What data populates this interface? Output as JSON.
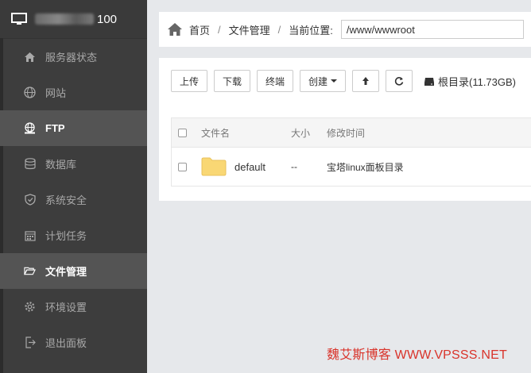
{
  "sidebar": {
    "server_title": "100",
    "items": [
      {
        "label": "服务器状态",
        "icon": "home-icon"
      },
      {
        "label": "网站",
        "icon": "globe-icon"
      },
      {
        "label": "FTP",
        "icon": "ftp-globe-icon"
      },
      {
        "label": "数据库",
        "icon": "database-icon"
      },
      {
        "label": "系统安全",
        "icon": "shield-icon"
      },
      {
        "label": "计划任务",
        "icon": "calendar-icon"
      },
      {
        "label": "文件管理",
        "icon": "folder-open-icon"
      },
      {
        "label": "环境设置",
        "icon": "gear-icon"
      },
      {
        "label": "退出面板",
        "icon": "logout-icon"
      }
    ]
  },
  "breadcrumb": {
    "home": "首页",
    "files": "文件管理",
    "current_label": "当前位置:",
    "path_value": "/www/wwwroot"
  },
  "toolbar": {
    "upload": "上传",
    "download": "下载",
    "terminal": "终端",
    "create": "创建",
    "up_icon": "arrow-up-icon",
    "refresh_icon": "refresh-icon",
    "disk": "根目录(11.73GB)"
  },
  "table": {
    "headers": {
      "name": "文件名",
      "size": "大小",
      "mtime": "修改时间"
    },
    "rows": [
      {
        "name": "default",
        "size": "--",
        "mtime": "宝塔linux面板目录"
      }
    ]
  },
  "watermark": "魏艾斯博客 WWW.VPSSS.NET",
  "colors": {
    "sidebar": "#3d3d3d",
    "active": "#545454",
    "accent": "#d9342b",
    "folder": "#f9d774"
  }
}
